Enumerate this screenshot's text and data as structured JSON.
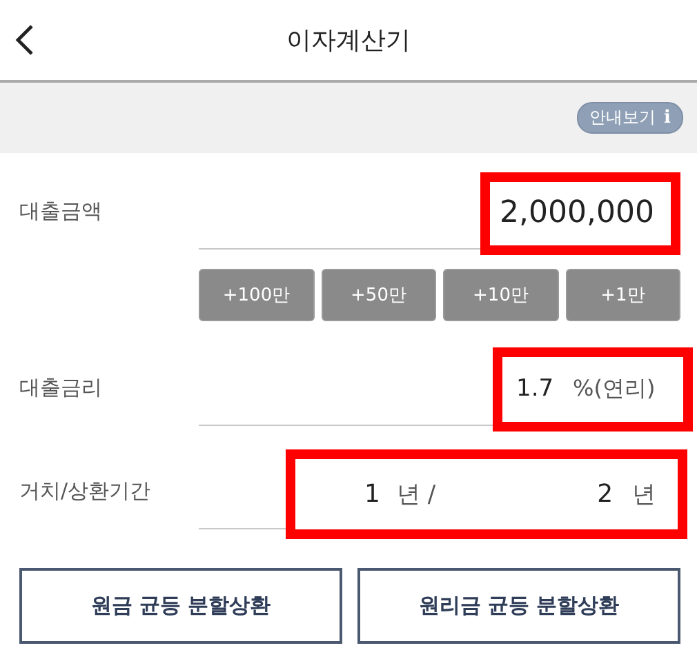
{
  "header": {
    "title": "이자계산기"
  },
  "guide_button": {
    "label": "안내보기",
    "icon": "i"
  },
  "fields": [
    {
      "kind": "amount",
      "label": "대출금액",
      "value": "2,000,000",
      "highlighted": true,
      "quick_add": [
        "+100만",
        "+50만",
        "+10만",
        "+1만"
      ]
    },
    {
      "kind": "rate",
      "label": "대출금리",
      "value": "1.7",
      "unit": "%(연리)",
      "highlighted": true
    },
    {
      "kind": "period",
      "label": "거치/상환기간",
      "grace_value": "1",
      "grace_unit": "년 /",
      "repay_value": "2",
      "repay_unit": "년",
      "highlighted": true
    }
  ],
  "method_buttons": [
    "원금 균등 분할상환",
    "원리금 균등 분할상환"
  ]
}
